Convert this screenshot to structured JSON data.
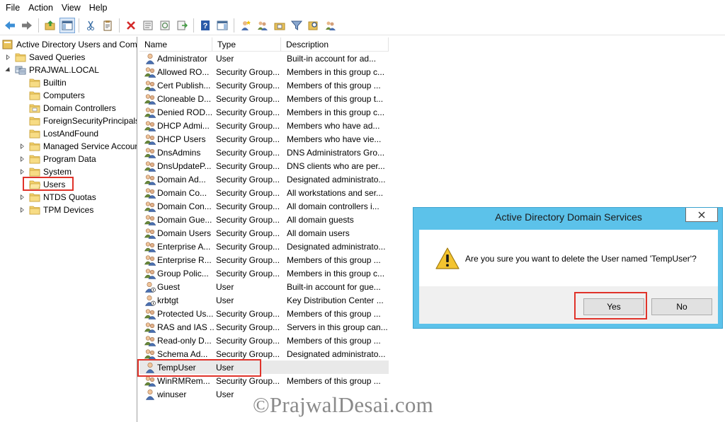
{
  "menu": [
    "File",
    "Action",
    "View",
    "Help"
  ],
  "toolbar_icons": [
    "back-arrow-icon",
    "forward-arrow-icon",
    "up-folder-icon",
    "show-console-tree-icon",
    "cut-icon",
    "copy-icon",
    "delete-icon",
    "properties-icon",
    "refresh-icon",
    "export-list-icon",
    "help-icon",
    "action-pane-icon",
    "new-user-icon",
    "new-group-icon",
    "new-ou-icon",
    "filter-icon",
    "find-icon",
    "add-to-group-icon"
  ],
  "tree": {
    "root": "Active Directory Users and Com",
    "items": [
      {
        "label": "Saved Queries",
        "indent": 1,
        "arrow": "right",
        "icon": "folder"
      },
      {
        "label": "PRAJWAL.LOCAL",
        "indent": 1,
        "arrow": "down",
        "icon": "domain"
      },
      {
        "label": "Builtin",
        "indent": 2,
        "arrow": "none",
        "icon": "folder"
      },
      {
        "label": "Computers",
        "indent": 2,
        "arrow": "none",
        "icon": "folder"
      },
      {
        "label": "Domain Controllers",
        "indent": 2,
        "arrow": "none",
        "icon": "ou"
      },
      {
        "label": "ForeignSecurityPrincipals",
        "indent": 2,
        "arrow": "none",
        "icon": "folder"
      },
      {
        "label": "LostAndFound",
        "indent": 2,
        "arrow": "none",
        "icon": "folder"
      },
      {
        "label": "Managed Service Accour",
        "indent": 2,
        "arrow": "right",
        "icon": "folder"
      },
      {
        "label": "Program Data",
        "indent": 2,
        "arrow": "right",
        "icon": "folder"
      },
      {
        "label": "System",
        "indent": 2,
        "arrow": "right",
        "icon": "folder"
      },
      {
        "label": "Users",
        "indent": 2,
        "arrow": "none",
        "icon": "folder-open",
        "highlighted": true
      },
      {
        "label": "NTDS Quotas",
        "indent": 2,
        "arrow": "right",
        "icon": "folder"
      },
      {
        "label": "TPM Devices",
        "indent": 2,
        "arrow": "right",
        "icon": "folder"
      }
    ]
  },
  "list": {
    "columns": [
      "Name",
      "Type",
      "Description"
    ],
    "rows": [
      {
        "name": "Administrator",
        "type": "User",
        "desc": "Built-in account for ad...",
        "icon": "user"
      },
      {
        "name": "Allowed RO...",
        "type": "Security Group...",
        "desc": "Members in this group c...",
        "icon": "group"
      },
      {
        "name": "Cert Publish...",
        "type": "Security Group...",
        "desc": "Members of this group ...",
        "icon": "group"
      },
      {
        "name": "Cloneable D...",
        "type": "Security Group...",
        "desc": "Members of this group t...",
        "icon": "group"
      },
      {
        "name": "Denied ROD...",
        "type": "Security Group...",
        "desc": "Members in this group c...",
        "icon": "group"
      },
      {
        "name": "DHCP Admi...",
        "type": "Security Group...",
        "desc": "Members who have ad...",
        "icon": "group"
      },
      {
        "name": "DHCP Users",
        "type": "Security Group...",
        "desc": "Members who have vie...",
        "icon": "group"
      },
      {
        "name": "DnsAdmins",
        "type": "Security Group...",
        "desc": "DNS Administrators Gro...",
        "icon": "group"
      },
      {
        "name": "DnsUpdateP...",
        "type": "Security Group...",
        "desc": "DNS clients who are per...",
        "icon": "group"
      },
      {
        "name": "Domain Ad...",
        "type": "Security Group...",
        "desc": "Designated administrato...",
        "icon": "group"
      },
      {
        "name": "Domain Co...",
        "type": "Security Group...",
        "desc": "All workstations and ser...",
        "icon": "group"
      },
      {
        "name": "Domain Con...",
        "type": "Security Group...",
        "desc": "All domain controllers i...",
        "icon": "group"
      },
      {
        "name": "Domain Gue...",
        "type": "Security Group...",
        "desc": "All domain guests",
        "icon": "group"
      },
      {
        "name": "Domain Users",
        "type": "Security Group...",
        "desc": "All domain users",
        "icon": "group"
      },
      {
        "name": "Enterprise A...",
        "type": "Security Group...",
        "desc": "Designated administrato...",
        "icon": "group"
      },
      {
        "name": "Enterprise R...",
        "type": "Security Group...",
        "desc": "Members of this group ...",
        "icon": "group"
      },
      {
        "name": "Group Polic...",
        "type": "Security Group...",
        "desc": "Members in this group c...",
        "icon": "group"
      },
      {
        "name": "Guest",
        "type": "User",
        "desc": "Built-in account for gue...",
        "icon": "user-disabled"
      },
      {
        "name": "krbtgt",
        "type": "User",
        "desc": "Key Distribution Center ...",
        "icon": "user-disabled"
      },
      {
        "name": "Protected Us...",
        "type": "Security Group...",
        "desc": "Members of this group ...",
        "icon": "group"
      },
      {
        "name": "RAS and IAS ...",
        "type": "Security Group...",
        "desc": "Servers in this group can...",
        "icon": "group"
      },
      {
        "name": "Read-only D...",
        "type": "Security Group...",
        "desc": "Members of this group ...",
        "icon": "group"
      },
      {
        "name": "Schema Ad...",
        "type": "Security Group...",
        "desc": "Designated administrato...",
        "icon": "group"
      },
      {
        "name": "TempUser",
        "type": "User",
        "desc": "",
        "icon": "user",
        "selected": true
      },
      {
        "name": "WinRMRem...",
        "type": "Security Group...",
        "desc": "Members of this group ...",
        "icon": "group"
      },
      {
        "name": "winuser",
        "type": "User",
        "desc": "",
        "icon": "user"
      }
    ]
  },
  "dialog": {
    "title": "Active Directory Domain Services",
    "message": "Are you sure you want to delete the User named 'TempUser'?",
    "yes_label": "Yes",
    "no_label": "No",
    "icon": "warning-icon"
  },
  "watermark": "©PrajwalDesai.com",
  "colors": {
    "dialog_frame": "#5cc2ea",
    "highlight_box": "#e0332a",
    "selected_row": "#e9e9e9"
  }
}
